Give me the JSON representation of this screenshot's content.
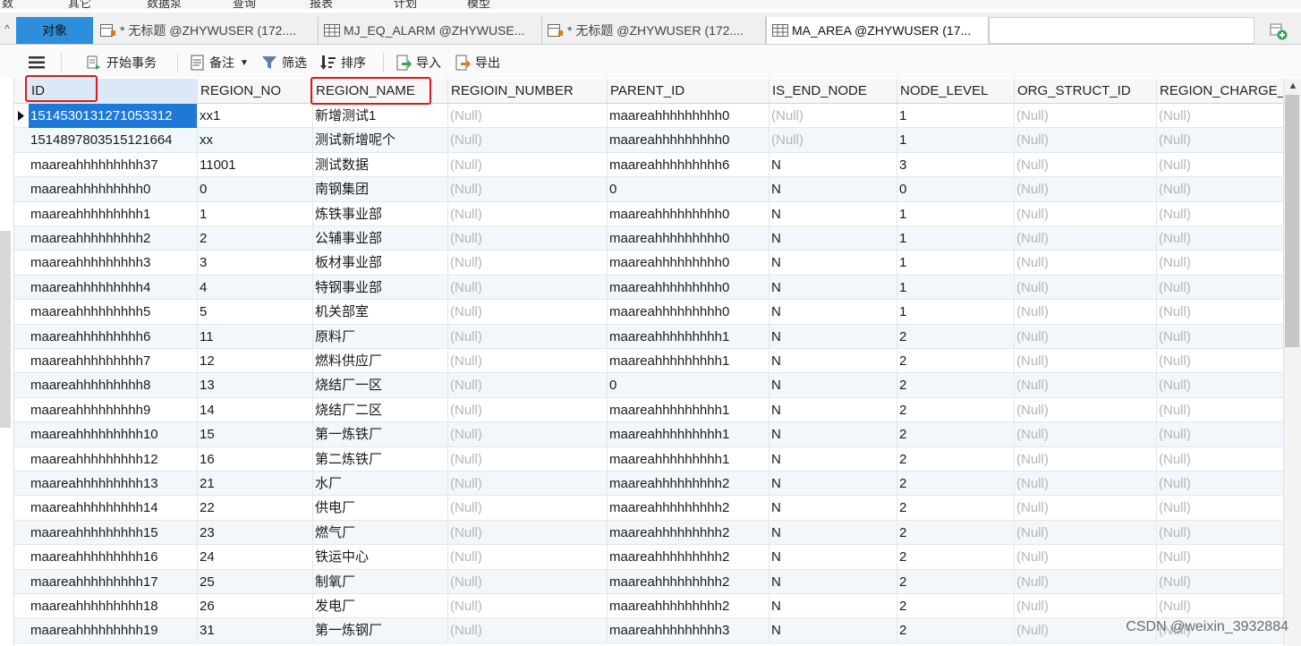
{
  "menu": {
    "items": [
      "数",
      "其它",
      "数据泵",
      "查询",
      "报表",
      "计划",
      "模型"
    ]
  },
  "tabs": {
    "objects_label": "对象",
    "documents": [
      {
        "label": "* 无标题 @ZHYWUSER (172....",
        "icon": "query-icon",
        "active": false
      },
      {
        "label": "MJ_EQ_ALARM @ZHYWUSE...",
        "icon": "table-icon",
        "active": false
      },
      {
        "label": "* 无标题 @ZHYWUSER (172....",
        "icon": "query-icon",
        "active": false
      },
      {
        "label": "MA_AREA @ZHYWUSER (17...",
        "icon": "table-icon",
        "active": true
      }
    ]
  },
  "toolbar": {
    "begin_transaction": "开始事务",
    "note": "备注",
    "filter": "筛选",
    "sort": "排序",
    "import": "导入",
    "export": "导出"
  },
  "grid": {
    "columns": [
      "ID",
      "REGION_NO",
      "REGION_NAME",
      "REGIOIN_NUMBER",
      "PARENT_ID",
      "IS_END_NODE",
      "NODE_LEVEL",
      "ORG_STRUCT_ID",
      "REGION_CHARGE_"
    ],
    "null_text": "(Null)",
    "rows": [
      [
        "1514530131271053312",
        "xx1",
        "新增测试1",
        null,
        "maareahhhhhhhhh0",
        null,
        "1",
        null,
        null
      ],
      [
        "1514897803515121664",
        "xx",
        "测试新增呢个",
        null,
        "maareahhhhhhhhh0",
        null,
        "1",
        null,
        null
      ],
      [
        "maareahhhhhhhhh37",
        "11001",
        "测试数据",
        null,
        "maareahhhhhhhhh6",
        "N",
        "3",
        null,
        null
      ],
      [
        "maareahhhhhhhhh0",
        "0",
        "南钢集团",
        null,
        "0",
        "N",
        "0",
        null,
        null
      ],
      [
        "maareahhhhhhhhh1",
        "1",
        "炼铁事业部",
        null,
        "maareahhhhhhhhh0",
        "N",
        "1",
        null,
        null
      ],
      [
        "maareahhhhhhhhh2",
        "2",
        "公辅事业部",
        null,
        "maareahhhhhhhhh0",
        "N",
        "1",
        null,
        null
      ],
      [
        "maareahhhhhhhhh3",
        "3",
        "板材事业部",
        null,
        "maareahhhhhhhhh0",
        "N",
        "1",
        null,
        null
      ],
      [
        "maareahhhhhhhhh4",
        "4",
        "特钢事业部",
        null,
        "maareahhhhhhhhh0",
        "N",
        "1",
        null,
        null
      ],
      [
        "maareahhhhhhhhh5",
        "5",
        "机关部室",
        null,
        "maareahhhhhhhhh0",
        "N",
        "1",
        null,
        null
      ],
      [
        "maareahhhhhhhhh6",
        "11",
        "原料厂",
        null,
        "maareahhhhhhhhh1",
        "N",
        "2",
        null,
        null
      ],
      [
        "maareahhhhhhhhh7",
        "12",
        "燃料供应厂",
        null,
        "maareahhhhhhhhh1",
        "N",
        "2",
        null,
        null
      ],
      [
        "maareahhhhhhhhh8",
        "13",
        "烧结厂一区",
        null,
        "0",
        "N",
        "2",
        null,
        null
      ],
      [
        "maareahhhhhhhhh9",
        "14",
        "烧结厂二区",
        null,
        "maareahhhhhhhhh1",
        "N",
        "2",
        null,
        null
      ],
      [
        "maareahhhhhhhhh10",
        "15",
        "第一炼铁厂",
        null,
        "maareahhhhhhhhh1",
        "N",
        "2",
        null,
        null
      ],
      [
        "maareahhhhhhhhh12",
        "16",
        "第二炼铁厂",
        null,
        "maareahhhhhhhhh1",
        "N",
        "2",
        null,
        null
      ],
      [
        "maareahhhhhhhhh13",
        "21",
        "水厂",
        null,
        "maareahhhhhhhhh2",
        "N",
        "2",
        null,
        null
      ],
      [
        "maareahhhhhhhhh14",
        "22",
        "供电厂",
        null,
        "maareahhhhhhhhh2",
        "N",
        "2",
        null,
        null
      ],
      [
        "maareahhhhhhhhh15",
        "23",
        "燃气厂",
        null,
        "maareahhhhhhhhh2",
        "N",
        "2",
        null,
        null
      ],
      [
        "maareahhhhhhhhh16",
        "24",
        "铁运中心",
        null,
        "maareahhhhhhhhh2",
        "N",
        "2",
        null,
        null
      ],
      [
        "maareahhhhhhhhh17",
        "25",
        "制氧厂",
        null,
        "maareahhhhhhhhh2",
        "N",
        "2",
        null,
        null
      ],
      [
        "maareahhhhhhhhh18",
        "26",
        "发电厂",
        null,
        "maareahhhhhhhhh2",
        "N",
        "2",
        null,
        null
      ],
      [
        "maareahhhhhhhhh19",
        "31",
        "第一炼钢厂",
        null,
        "maareahhhhhhhhh3",
        "N",
        "2",
        null,
        null
      ]
    ]
  },
  "watermark": "CSDN @weixin_3932884",
  "colors": {
    "selection": "#1e78d7",
    "objects_tab": "#2d8fdc",
    "highlight_box": "#e01818",
    "null_text": "#b5b5b5"
  }
}
